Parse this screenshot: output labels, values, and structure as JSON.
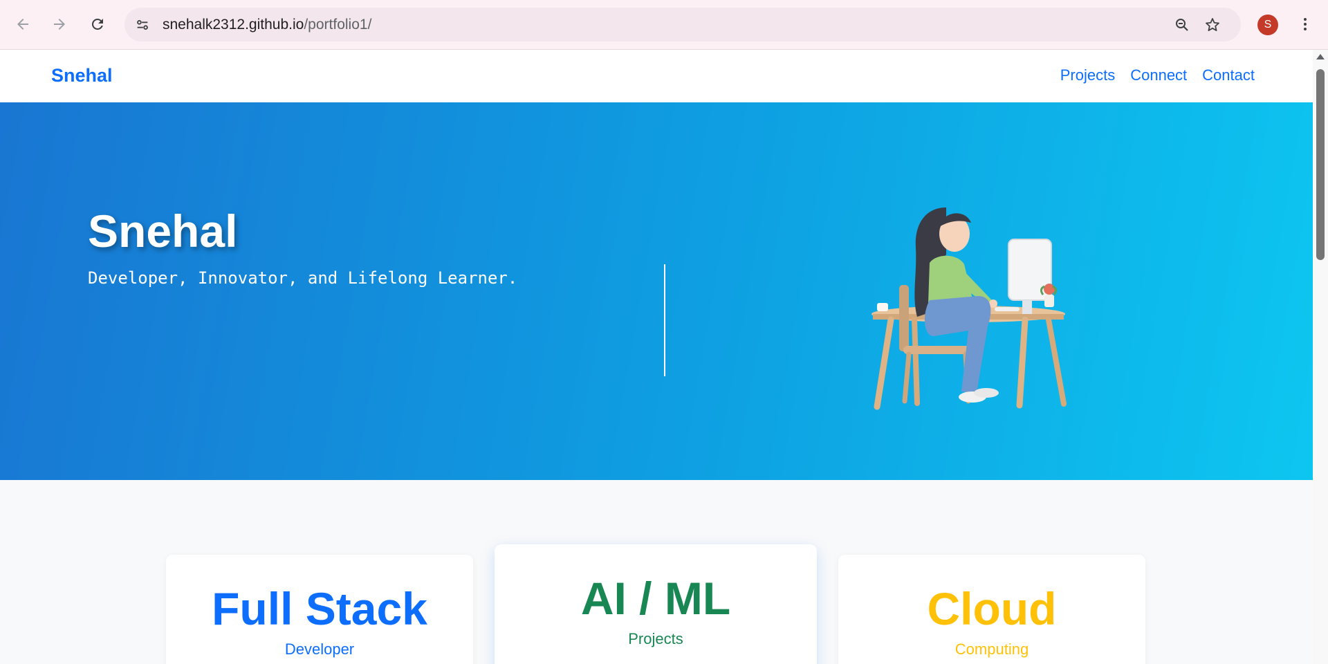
{
  "browser": {
    "url_host": "snehalk2312.github.io",
    "url_path": "/portfolio1/",
    "profile_initial": "S",
    "icons": [
      "back-icon",
      "forward-icon",
      "reload-icon",
      "site-settings-icon",
      "zoom-icon",
      "bookmark-star-icon",
      "more-vert-icon"
    ]
  },
  "navbar": {
    "brand": "Snehal",
    "links": [
      "Projects",
      "Connect",
      "Contact"
    ]
  },
  "hero": {
    "title": "Snehal",
    "tagline": "Developer, Innovator, and Lifelong Learner."
  },
  "cards": [
    {
      "title": "Full Stack",
      "subtitle": "Developer",
      "color": "#0d6efd",
      "subcolor": "#0d6efd"
    },
    {
      "title": "AI / ML",
      "subtitle": "Projects",
      "color": "#198754",
      "subcolor": "#198754"
    },
    {
      "title": "Cloud",
      "subtitle": "Computing",
      "color": "#ffc107",
      "subcolor": "#ffc107"
    }
  ],
  "colors": {
    "accent": "#0d6efd",
    "hero_gradient_start": "#1976d2",
    "hero_gradient_end": "#0dc6f0",
    "avatar": "#c53929"
  }
}
